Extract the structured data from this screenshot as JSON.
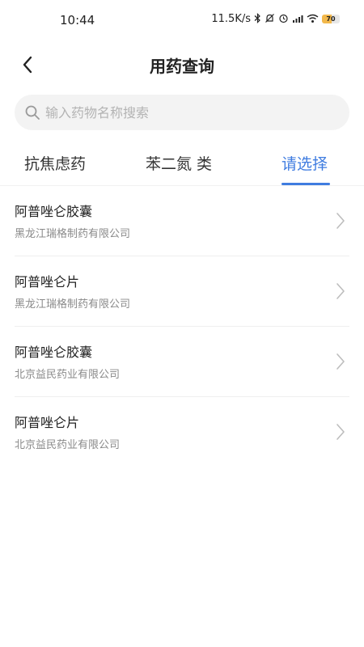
{
  "status_bar": {
    "time": "10:44",
    "net_speed": "11.5K/s",
    "battery": "70",
    "icons": [
      "bluetooth-icon",
      "mute-icon",
      "alarm-icon",
      "hd-signal-icon",
      "wifi-icon",
      "battery-icon"
    ]
  },
  "nav": {
    "title": "用药查询",
    "back_icon": "chevron-left-icon"
  },
  "search": {
    "placeholder": "输入药物名称搜索",
    "value": "",
    "icon": "search-icon"
  },
  "tabs": [
    {
      "label": "抗焦虑药",
      "active": false
    },
    {
      "label": "苯二氮 类",
      "active": false
    },
    {
      "label": "请选择",
      "active": true
    }
  ],
  "colors": {
    "accent": "#3f7ce0",
    "search_bg": "#f3f3f3",
    "secondary_text": "#8a8a8a"
  },
  "drugs": [
    {
      "name": "阿普唑仑胶囊",
      "maker": "黑龙江瑞格制药有限公司"
    },
    {
      "name": "阿普唑仑片",
      "maker": "黑龙江瑞格制药有限公司"
    },
    {
      "name": "阿普唑仑胶囊",
      "maker": "北京益民药业有限公司"
    },
    {
      "name": "阿普唑仑片",
      "maker": "北京益民药业有限公司"
    }
  ]
}
